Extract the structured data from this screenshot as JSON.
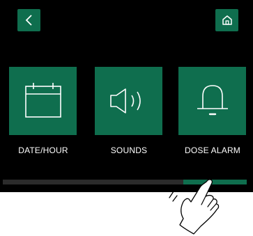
{
  "header": {
    "back_icon": "chevron-left-icon",
    "home_icon": "home-icon"
  },
  "tiles": [
    {
      "label": "DATE/HOUR",
      "icon": "calendar-icon"
    },
    {
      "label": "SOUNDS",
      "icon": "speaker-icon"
    },
    {
      "label": "DOSE ALARM",
      "icon": "bell-icon"
    }
  ],
  "scrollbar": {
    "thumb_start_fraction": 0.74,
    "thumb_size_fraction": 0.26
  },
  "colors": {
    "accent": "#0f6e4e",
    "background": "#000000",
    "track": "#2b2b2b",
    "text": "#ffffff"
  },
  "gesture": {
    "icon": "swipe-hand-icon"
  }
}
